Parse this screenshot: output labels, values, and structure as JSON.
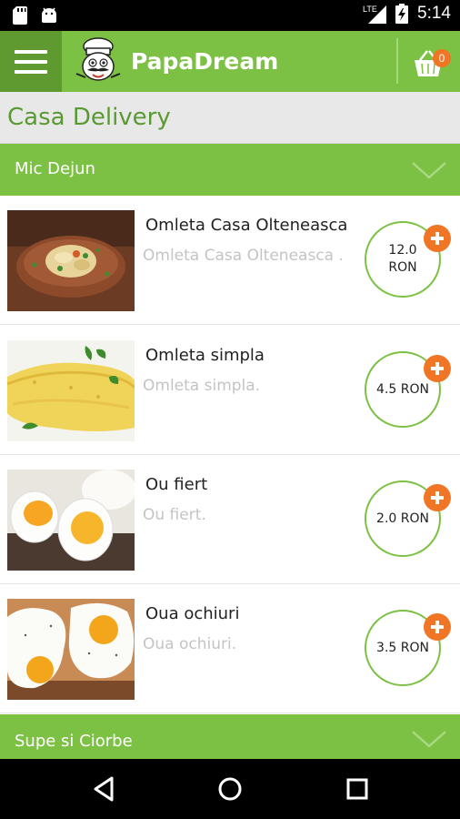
{
  "status_bar": {
    "time": "5:14",
    "network": "LTE",
    "icons": [
      "sd-card-icon",
      "android-icon",
      "signal-icon",
      "battery-charging-icon"
    ]
  },
  "app_bar": {
    "title": "PapaDream",
    "menu_icon": "hamburger-icon",
    "cart_icon": "basket-icon",
    "cart_count": "0"
  },
  "page": {
    "title": "Casa Delivery"
  },
  "categories": [
    {
      "label": "Mic Dejun",
      "expanded": true,
      "items": [
        {
          "name": "Omleta Casa Olteneasca",
          "description": "Omleta Casa Olteneasca .",
          "price": "12.0 RON",
          "image": "omelette-bowl"
        },
        {
          "name": "Omleta simpla",
          "description": "Omleta simpla.",
          "price": "4.5 RON",
          "image": "omelette-plain"
        },
        {
          "name": "Ou fiert",
          "description": "Ou fiert.",
          "price": "2.0 RON",
          "image": "boiled-eggs"
        },
        {
          "name": "Oua ochiuri",
          "description": "Oua ochiuri.",
          "price": "3.5 RON",
          "image": "fried-eggs"
        }
      ]
    },
    {
      "label": "Supe si Ciorbe",
      "expanded": false,
      "items": []
    }
  ],
  "nav_bar": {
    "back_icon": "back-triangle-icon",
    "home_icon": "home-circle-icon",
    "recents_icon": "recents-square-icon"
  },
  "colors": {
    "primary_green": "#7cc143",
    "dark_green": "#5e9a2f",
    "accent_orange": "#f07524",
    "title_green": "#5a9a32"
  }
}
